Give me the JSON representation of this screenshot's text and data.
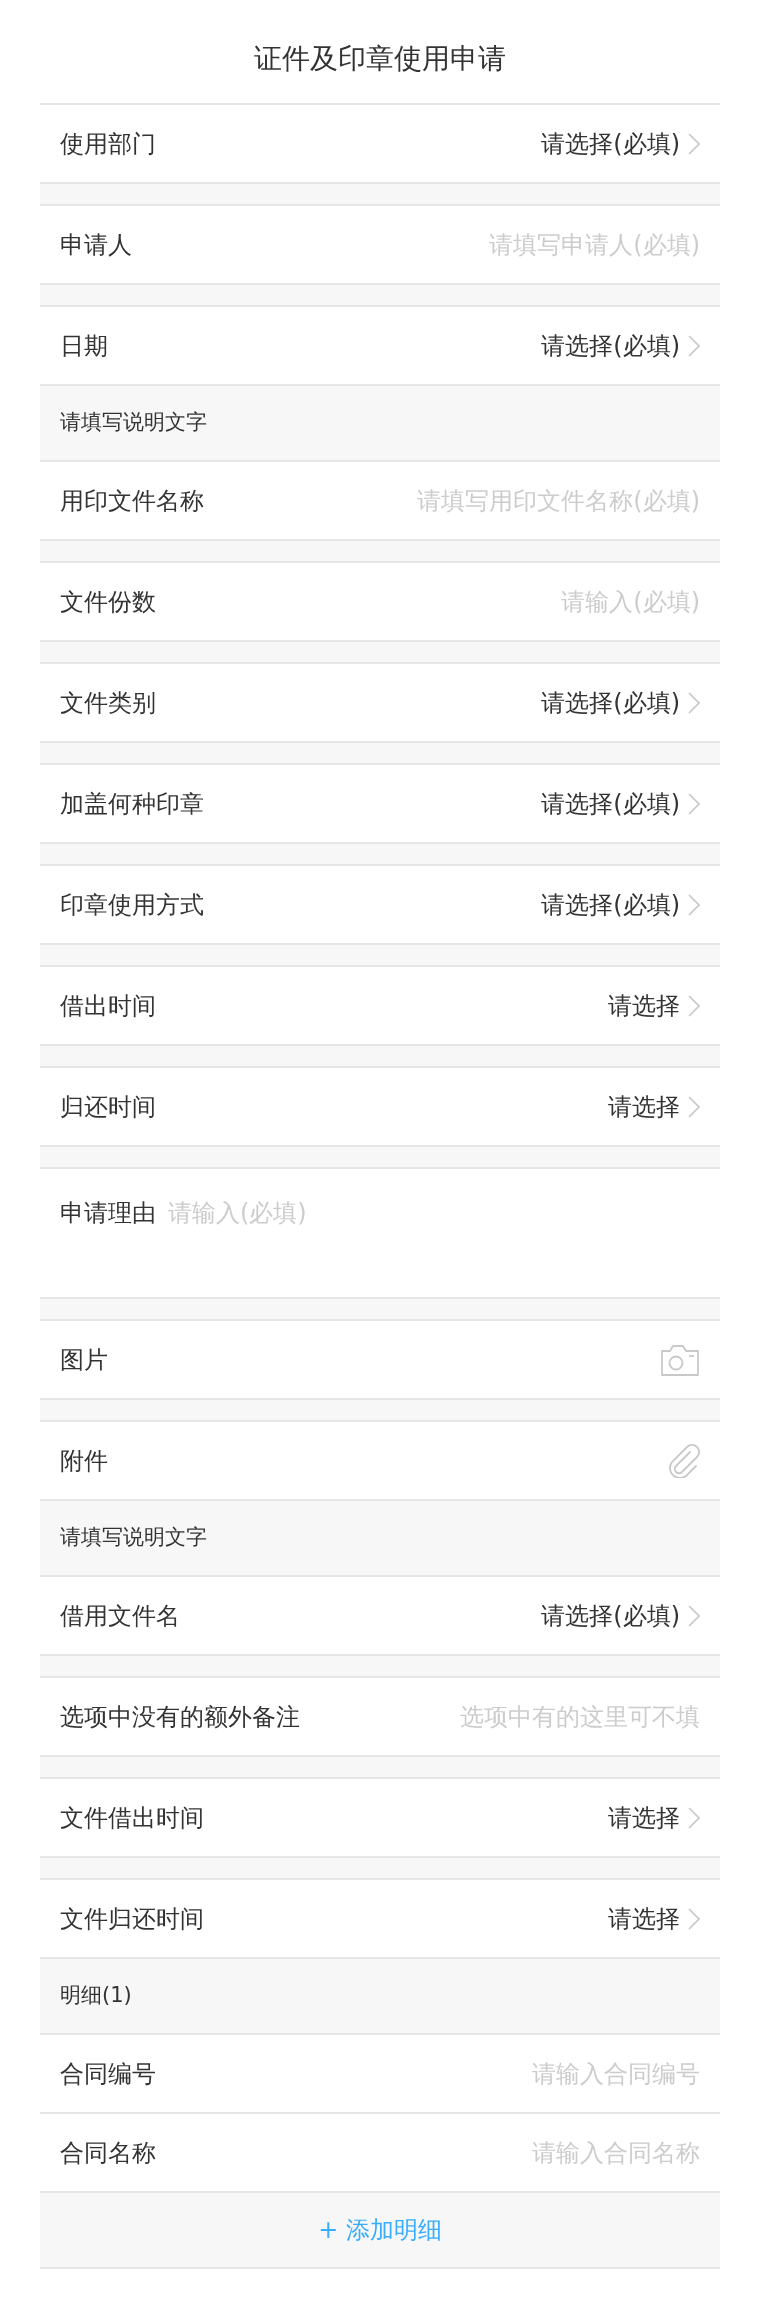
{
  "title": "证件及印章使用申请",
  "groups": [
    {
      "fields": [
        {
          "kind": "select",
          "label": "使用部门",
          "value": "请选择(必填)"
        }
      ]
    },
    {
      "fields": [
        {
          "kind": "input",
          "label": "申请人",
          "placeholder": "请填写申请人(必填)"
        }
      ]
    },
    {
      "fields": [
        {
          "kind": "select",
          "label": "日期",
          "value": "请选择(必填)"
        },
        {
          "kind": "note",
          "text": "请填写说明文字"
        },
        {
          "kind": "input",
          "label": "用印文件名称",
          "placeholder": "请填写用印文件名称(必填)"
        }
      ]
    },
    {
      "fields": [
        {
          "kind": "input",
          "label": "文件份数",
          "placeholder": "请输入(必填)"
        }
      ]
    },
    {
      "fields": [
        {
          "kind": "select",
          "label": "文件类别",
          "value": "请选择(必填)"
        }
      ]
    },
    {
      "fields": [
        {
          "kind": "select",
          "label": "加盖何种印章",
          "value": "请选择(必填)"
        }
      ]
    },
    {
      "fields": [
        {
          "kind": "select",
          "label": "印章使用方式",
          "value": "请选择(必填)"
        }
      ]
    },
    {
      "fields": [
        {
          "kind": "select",
          "label": "借出时间",
          "value": "请选择"
        }
      ]
    },
    {
      "fields": [
        {
          "kind": "select",
          "label": "归还时间",
          "value": "请选择"
        }
      ]
    },
    {
      "fields": [
        {
          "kind": "textarea",
          "label": "申请理由",
          "placeholder": "请输入(必填)"
        }
      ]
    },
    {
      "fields": [
        {
          "kind": "image",
          "label": "图片"
        }
      ]
    },
    {
      "fields": [
        {
          "kind": "attachment",
          "label": "附件"
        },
        {
          "kind": "note",
          "text": "请填写说明文字"
        },
        {
          "kind": "select",
          "label": "借用文件名",
          "value": "请选择(必填)"
        }
      ]
    },
    {
      "fields": [
        {
          "kind": "input",
          "label": "选项中没有的额外备注",
          "placeholder": "选项中有的这里可不填"
        }
      ]
    },
    {
      "fields": [
        {
          "kind": "select",
          "label": "文件借出时间",
          "value": "请选择"
        }
      ]
    },
    {
      "fields": [
        {
          "kind": "select",
          "label": "文件归还时间",
          "value": "请选择"
        },
        {
          "kind": "note",
          "text": "明细(1)"
        },
        {
          "kind": "input",
          "label": "合同编号",
          "placeholder": "请输入合同编号"
        },
        {
          "kind": "input",
          "label": "合同名称",
          "placeholder": "请输入合同名称"
        },
        {
          "kind": "add",
          "text": "+ 添加明细"
        }
      ]
    }
  ]
}
